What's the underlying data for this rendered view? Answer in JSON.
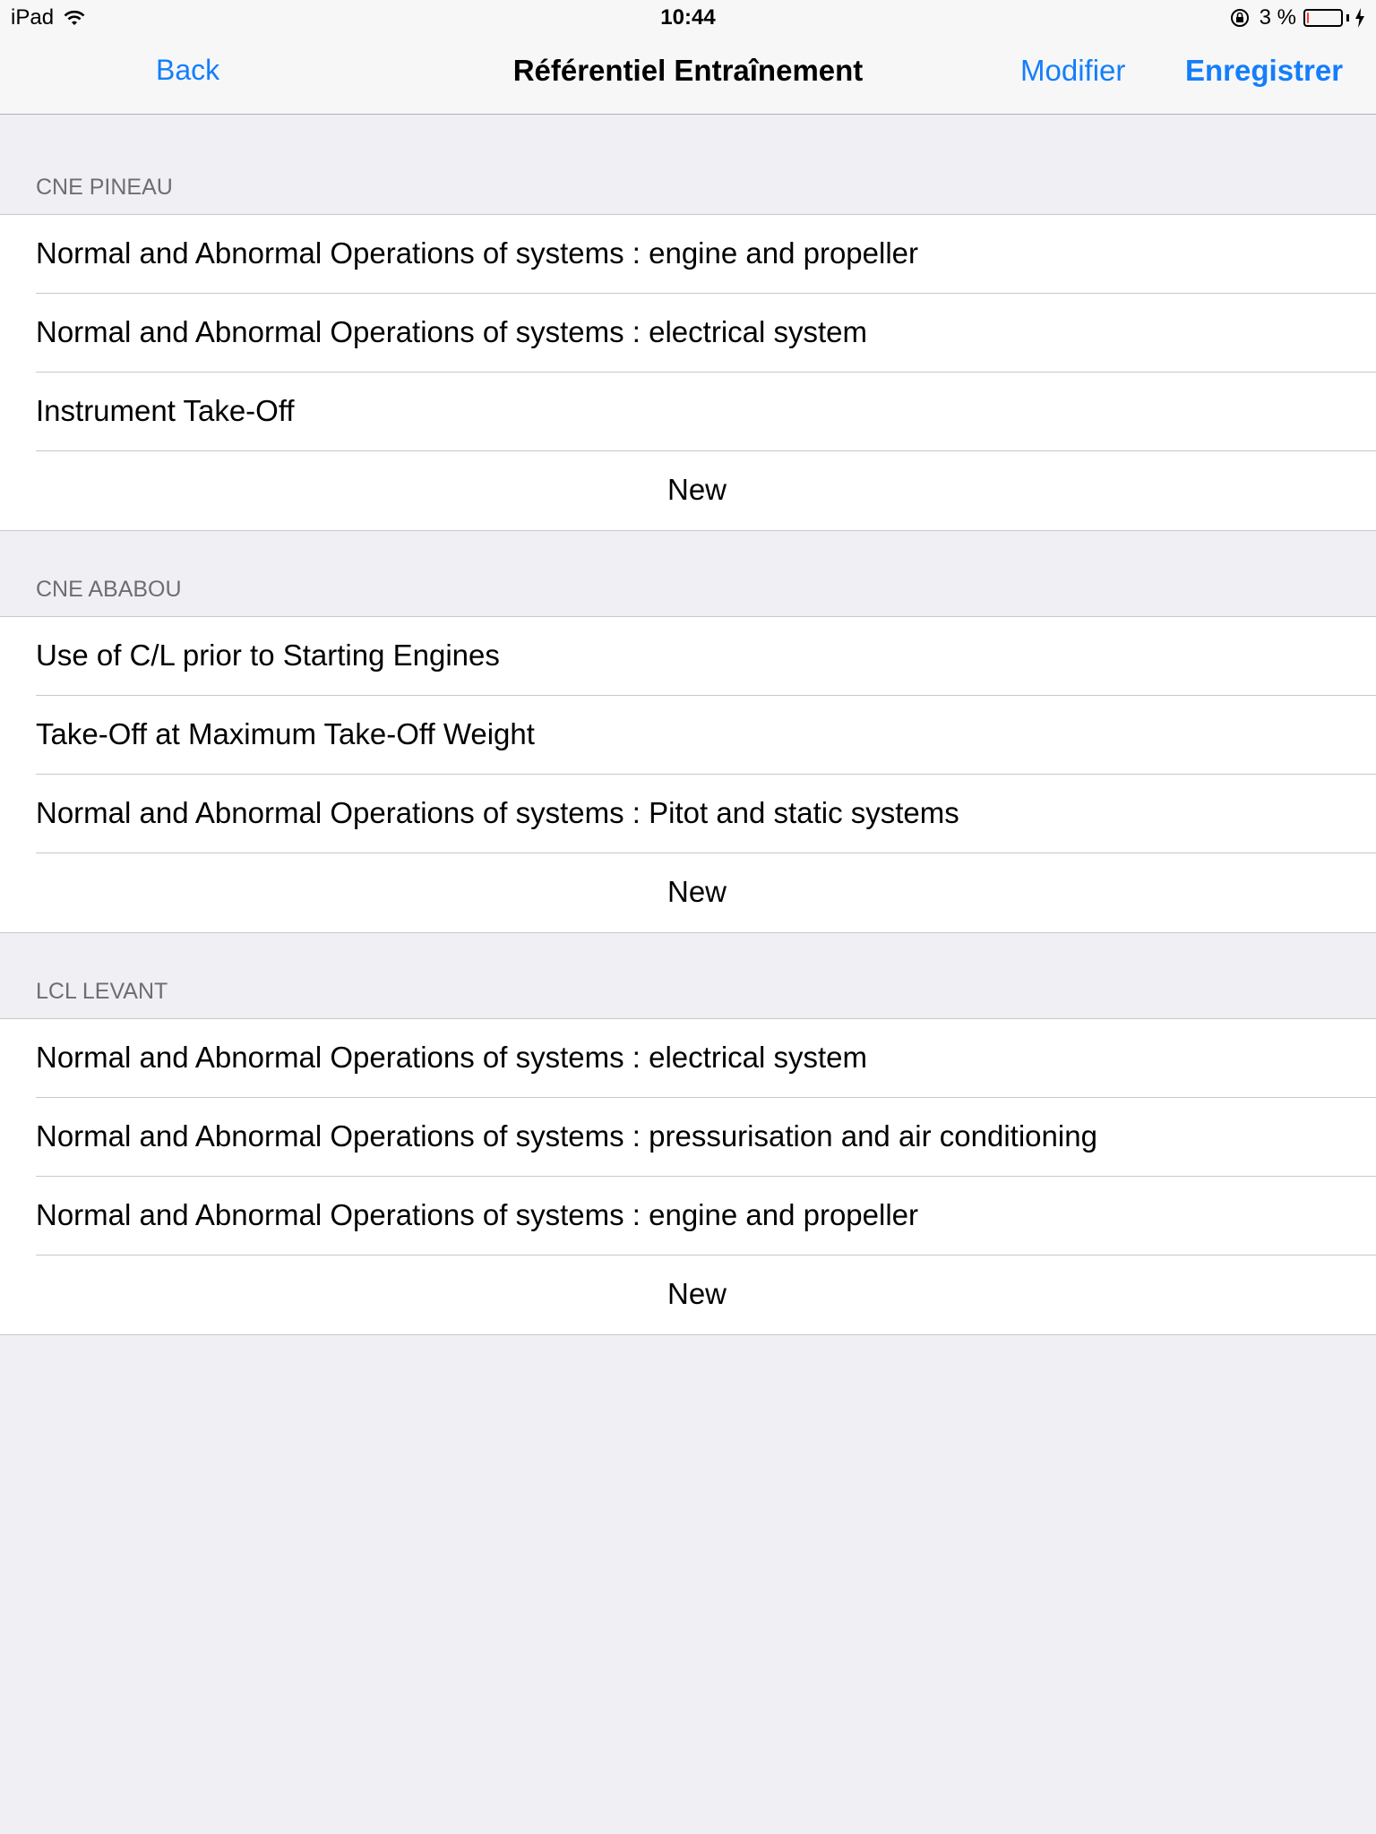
{
  "status_bar": {
    "device": "iPad",
    "time": "10:44",
    "battery_percent": "3 %",
    "battery_level": 0.03
  },
  "nav": {
    "back_label": "Back",
    "title": "Référentiel Entraînement",
    "modifier_label": "Modifier",
    "save_label": "Enregistrer"
  },
  "sections": [
    {
      "header": "CNE PINEAU",
      "items": [
        "Normal and Abnormal Operations of systems : engine and propeller",
        "Normal and Abnormal Operations of systems : electrical system",
        "Instrument Take-Off"
      ],
      "new_label": "New"
    },
    {
      "header": "CNE ABABOU",
      "items": [
        "Use of C/L prior to Starting Engines",
        "Take-Off at Maximum Take-Off Weight",
        "Normal and Abnormal Operations of systems : Pitot and static systems"
      ],
      "new_label": "New"
    },
    {
      "header": "LCL LEVANT",
      "items": [
        "Normal and Abnormal Operations of systems : electrical system",
        "Normal and Abnormal Operations of systems : pressurisation and air conditioning",
        "Normal and Abnormal Operations of systems : engine and propeller"
      ],
      "new_label": "New"
    }
  ],
  "colors": {
    "accent": "#147efb",
    "background": "#efeff4",
    "battery_low": "#ff3b30"
  }
}
